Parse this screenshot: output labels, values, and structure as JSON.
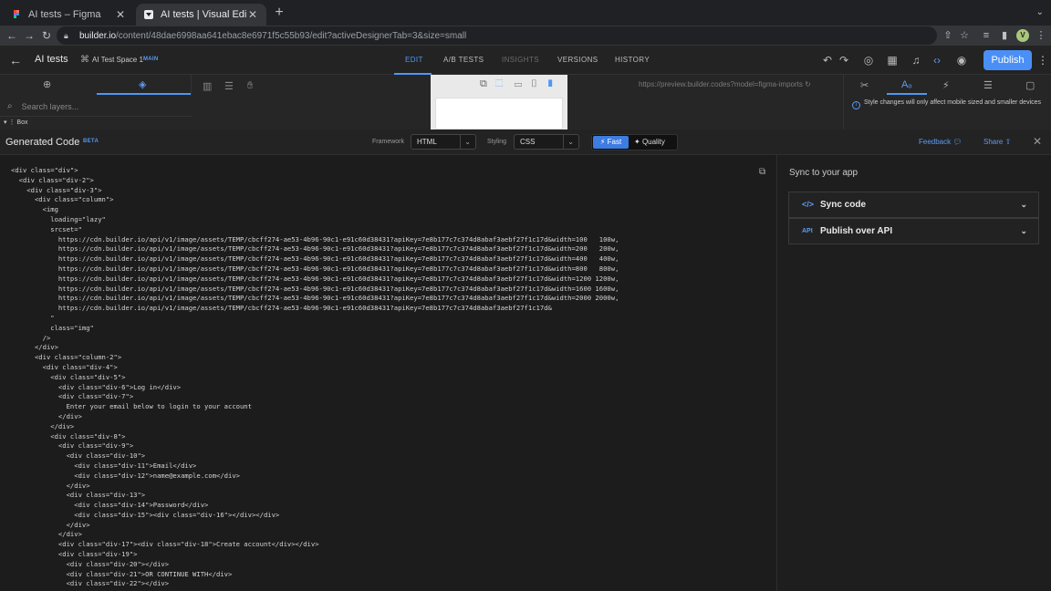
{
  "browser": {
    "tabs": [
      {
        "title": "AI tests – Figma",
        "active": false
      },
      {
        "title": "AI tests | Visual Editor | Builder",
        "active": true
      }
    ],
    "url_host": "builder.io",
    "url_path": "/content/48dae6998aa641ebac8e6971f5c55b93/edit?activeDesignerTab=3&size=small",
    "profile_initial": "V"
  },
  "builder": {
    "project": "AI tests",
    "space": "AI Test Space 1",
    "branch_badge": "MAIN",
    "nav_tabs": [
      "EDIT",
      "A/B TESTS",
      "INSIGHTS",
      "VERSIONS",
      "HISTORY"
    ],
    "publish_label": "Publish"
  },
  "editor": {
    "search_placeholder": "Search layers...",
    "layer_box": "Box",
    "preview_url": "https://preview.builder.codes?model=figma-imports",
    "style_notice": "Style changes will only affect mobile sized and smaller devices"
  },
  "generated": {
    "title": "Generated Code",
    "badge": "BETA",
    "framework_label": "Framework",
    "framework_value": "HTML",
    "styling_label": "Styling",
    "styling_value": "CSS",
    "fast_label": "Fast",
    "quality_label": "Quality",
    "feedback_label": "Feedback",
    "share_label": "Share"
  },
  "code_lines": [
    "<div class=\"div\">",
    "  <div class=\"div-2\">",
    "    <div class=\"div-3\">",
    "      <div class=\"column\">",
    "        <img",
    "          loading=\"lazy\"",
    "          srcset=\"",
    "            https://cdn.builder.io/api/v1/image/assets/TEMP/cbcff274-ae53-4b96-90c1-e91c60d38431?apiKey=7e8b177c7c374d8abaf3aebf27f1c17d&width=100   100w,",
    "            https://cdn.builder.io/api/v1/image/assets/TEMP/cbcff274-ae53-4b96-90c1-e91c60d38431?apiKey=7e8b177c7c374d8abaf3aebf27f1c17d&width=200   200w,",
    "            https://cdn.builder.io/api/v1/image/assets/TEMP/cbcff274-ae53-4b96-90c1-e91c60d38431?apiKey=7e8b177c7c374d8abaf3aebf27f1c17d&width=400   400w,",
    "            https://cdn.builder.io/api/v1/image/assets/TEMP/cbcff274-ae53-4b96-90c1-e91c60d38431?apiKey=7e8b177c7c374d8abaf3aebf27f1c17d&width=800   800w,",
    "            https://cdn.builder.io/api/v1/image/assets/TEMP/cbcff274-ae53-4b96-90c1-e91c60d38431?apiKey=7e8b177c7c374d8abaf3aebf27f1c17d&width=1200 1200w,",
    "            https://cdn.builder.io/api/v1/image/assets/TEMP/cbcff274-ae53-4b96-90c1-e91c60d38431?apiKey=7e8b177c7c374d8abaf3aebf27f1c17d&width=1600 1600w,",
    "            https://cdn.builder.io/api/v1/image/assets/TEMP/cbcff274-ae53-4b96-90c1-e91c60d38431?apiKey=7e8b177c7c374d8abaf3aebf27f1c17d&width=2000 2000w,",
    "            https://cdn.builder.io/api/v1/image/assets/TEMP/cbcff274-ae53-4b96-90c1-e91c60d38431?apiKey=7e8b177c7c374d8abaf3aebf27f1c17d&",
    "          \"",
    "          class=\"img\"",
    "        />",
    "      </div>",
    "      <div class=\"column-2\">",
    "        <div class=\"div-4\">",
    "          <div class=\"div-5\">",
    "            <div class=\"div-6\">Log in</div>",
    "            <div class=\"div-7\">",
    "              Enter your email below to login to your account",
    "            </div>",
    "          </div>",
    "          <div class=\"div-8\">",
    "            <div class=\"div-9\">",
    "              <div class=\"div-10\">",
    "                <div class=\"div-11\">Email</div>",
    "                <div class=\"div-12\">name@example.com</div>",
    "              </div>",
    "              <div class=\"div-13\">",
    "                <div class=\"div-14\">Password</div>",
    "                <div class=\"div-15\"><div class=\"div-16\"></div></div>",
    "              </div>",
    "            </div>",
    "            <div class=\"div-17\"><div class=\"div-18\">Create account</div></div>",
    "            <div class=\"div-19\">",
    "              <div class=\"div-20\"></div>",
    "              <div class=\"div-21\">OR CONTINUE WITH</div>",
    "              <div class=\"div-22\"></div>"
  ],
  "sync": {
    "title": "Sync to your app",
    "sync_code": "Sync code",
    "publish_api": "Publish over API",
    "api_icon_text": "API"
  }
}
